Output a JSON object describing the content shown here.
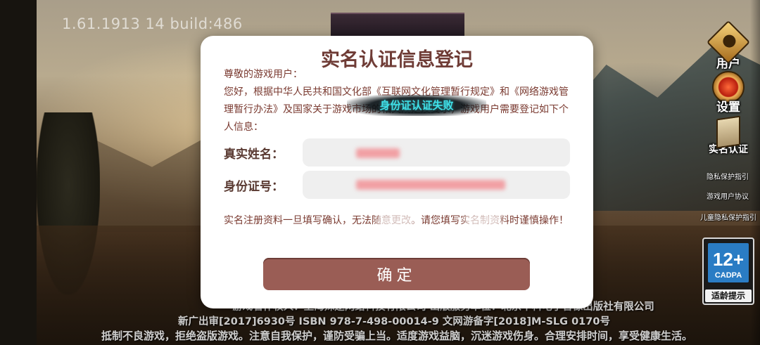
{
  "build": {
    "version": "1.61.1913 14 build:486"
  },
  "side_menu": {
    "user_label": "用户",
    "settings_label": "设置",
    "realname_label": "实名认证",
    "privacy_guide": "隐私保护指引",
    "user_agreement": "游戏用户协议",
    "child_privacy": "儿童隐私保护指引"
  },
  "age_rating": {
    "value": "12+",
    "org": "CADPA",
    "tip": "适龄提示"
  },
  "dialog": {
    "title": "实名认证信息登记",
    "greeting": "尊敬的游戏用户：",
    "intro": "您好，根据中华人民共和国文化部《互联网文化管理暂行规定》和《网络游戏管理暂行办法》及国家关于游戏市场的相关规定及要求，游戏用户需要登记如下个人信息：",
    "name_label": "真实姓名：",
    "id_label": "身份证号：",
    "name_value": "",
    "id_value": "",
    "notice": "实名注册资料一旦填写确认，无法随意更改。请您填写实名制资料时谨慎操作！",
    "confirm_label": "确定"
  },
  "toast": {
    "message": "身份证认证失败"
  },
  "legal": {
    "line1": "游戏著作权人：上海殊途网络科技有限公司  出版服务单位：北京中科电子音像出版社有限公司",
    "line2": "新广出审[2017]6930号  ISBN 978-7-498-00014-9  文网游备字[2018]M-SLG 0170号",
    "line3": "抵制不良游戏，拒绝盗版游戏。注意自我保护，谨防受骗上当。适度游戏益脑，沉迷游戏伤身。合理安排时间，享受健康生活。"
  },
  "colors": {
    "dialog_title": "#6f3c36",
    "body_text": "#7a3a30",
    "confirm_button": "#9a5d55",
    "toast_text": "#3fe0e8",
    "age_badge_blue": "#2a7cc4"
  }
}
